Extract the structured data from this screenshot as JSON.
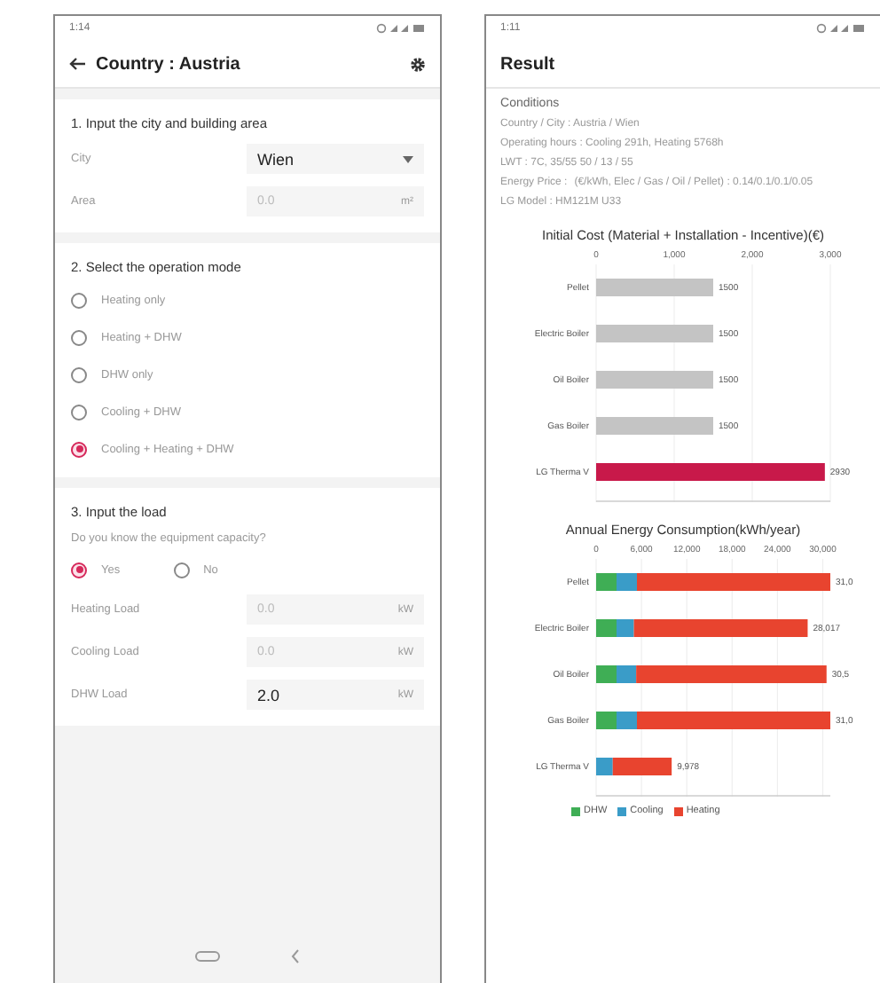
{
  "input_screen": {
    "status_time": "1:14",
    "title": "Country : Austria",
    "section_1": {
      "heading": "1. Input the city and building area",
      "fields": [
        {
          "label": "City",
          "kind": "dropdown",
          "value": "Wien"
        },
        {
          "label": "Area",
          "kind": "text",
          "placeholder": "0.0",
          "unit": "m²"
        }
      ]
    },
    "section_2": {
      "heading": "2. Select the operation mode",
      "options": [
        {
          "label": "Heating only",
          "selected": false
        },
        {
          "label": "Heating + DHW",
          "selected": false
        },
        {
          "label": "DHW only",
          "selected": false
        },
        {
          "label": "Cooling + DHW",
          "selected": false
        },
        {
          "label": "Cooling + Heating + DHW",
          "selected": true
        }
      ]
    },
    "section_3": {
      "heading": "3. Input the load",
      "question": "Do you know the equipment capacity?",
      "answers": [
        {
          "label": "Yes",
          "selected": true
        },
        {
          "label": "No",
          "selected": false
        }
      ],
      "loads": [
        {
          "label": "Heating Load",
          "placeholder": "0.0",
          "unit": "kW"
        },
        {
          "label": "Cooling Load",
          "placeholder": "0.0",
          "unit": "kW"
        },
        {
          "label": "DHW Load",
          "value": "2.0",
          "unit": "kW"
        }
      ]
    }
  },
  "result_screen": {
    "status_time": "1:11",
    "title": "Result",
    "conditions_heading": "Conditions",
    "conditions": [
      {
        "label": "Country / City : Austria / Wien"
      },
      {
        "label": "Operating hours : Cooling 291h, Heating 5768h"
      },
      {
        "label": "LWT : 7C, 35/55 50 / 13 / 55"
      },
      {
        "label": "Energy Price :",
        "value": "(€/kWh, Elec / Gas / Oil / Pellet) : 0.14/0.1/0.1/0.05"
      },
      {
        "label": "LG Model : HM121M U33"
      }
    ],
    "charts": [
      {
        "chart_data": {
          "type": "bar",
          "orientation": "horizontal",
          "stacked": true,
          "title": "Initial Cost (Material + Installation - Incentive)(€)",
          "categories": [
            "Pellet",
            "Electric Boiler",
            "Oil Boiler",
            "Gas Boiler",
            "LG Therma V"
          ],
          "series": [
            {
              "color": "#c4c4c4",
              "values": [
                1500,
                1500,
                1500,
                1500,
                null
              ]
            },
            {
              "color": "#c8194a",
              "values": [
                null,
                null,
                null,
                null,
                2930
              ]
            }
          ],
          "xlim": [
            0,
            3000
          ],
          "grid": true,
          "xticks": [
            {
              "value": 0,
              "label": "0"
            },
            {
              "value": 1000,
              "label": "1,000"
            },
            {
              "value": 2000,
              "label": "2,000"
            },
            {
              "value": 3000,
              "label": "3,000"
            }
          ],
          "value_labels": [
            "1500",
            "1500",
            "1500",
            "1500",
            "2930"
          ]
        }
      },
      {
        "chart_data": {
          "type": "bar",
          "orientation": "horizontal",
          "stacked": true,
          "title": "Annual Energy Consumption(kWh/year)",
          "categories": [
            "Pellet",
            "Electric Boiler",
            "Oil Boiler",
            "Gas Boiler",
            "LG Therma V"
          ],
          "series": [
            {
              "name": "DHW",
              "color": "#3fae55",
              "values": [
                2700,
                2700,
                2700,
                2700,
                null
              ]
            },
            {
              "name": "Cooling",
              "color": "#3a9cc8",
              "values": [
                2700,
                2300,
                2600,
                2700,
                2200
              ]
            },
            {
              "name": "Heating",
              "color": "#e8442f",
              "values": [
                25600,
                23000,
                25200,
                25600,
                7800
              ]
            }
          ],
          "xlim": [
            0,
            31000
          ],
          "grid": true,
          "xticks": [
            {
              "value": 0,
              "label": "0"
            },
            {
              "value": 6000,
              "label": "6,000"
            },
            {
              "value": 12000,
              "label": "12,000"
            },
            {
              "value": 18000,
              "label": "18,000"
            },
            {
              "value": 24000,
              "label": "24,000"
            },
            {
              "value": 30000,
              "label": "30,000"
            }
          ],
          "value_labels": [
            "31,0",
            "28,017",
            "30,5",
            "31,0",
            "9,978"
          ]
        }
      }
    ]
  }
}
